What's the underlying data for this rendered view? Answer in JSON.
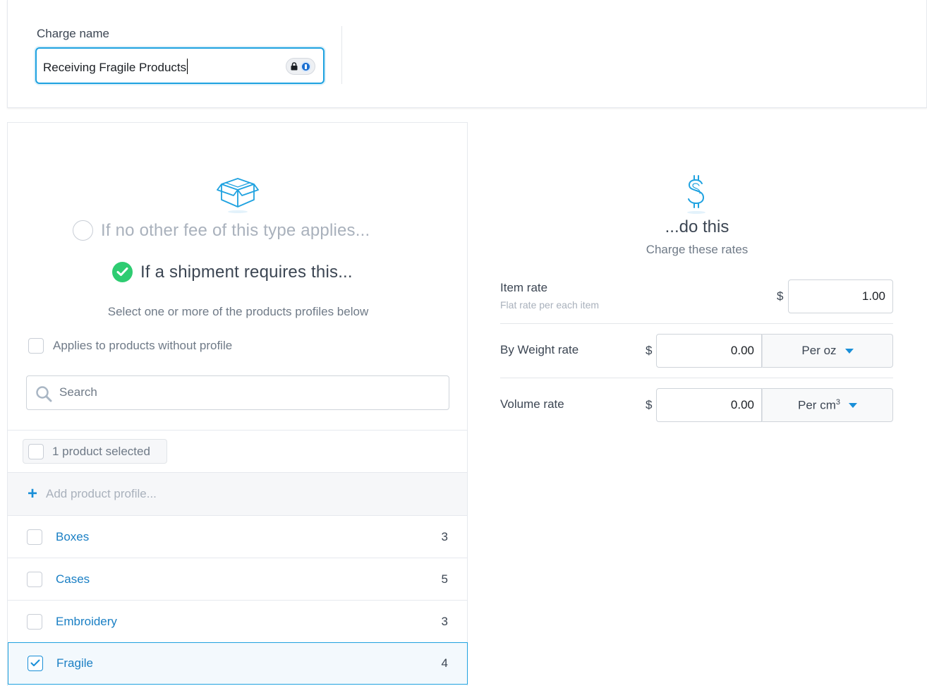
{
  "charge": {
    "label": "Charge name",
    "value": "Receiving Fragile Products"
  },
  "conditions": {
    "option_default": "If no other fee of this type applies...",
    "option_requires": "If a shipment requires this...",
    "hint": "Select one or more of the products profiles below",
    "applies_without_profile": "Applies to products without profile",
    "search_placeholder": "Search",
    "selected_summary": "1 product selected",
    "add_profile": "Add product profile..."
  },
  "profiles": [
    {
      "name": "Boxes",
      "count": "3",
      "checked": false
    },
    {
      "name": "Cases",
      "count": "5",
      "checked": false
    },
    {
      "name": "Embroidery",
      "count": "3",
      "checked": false
    },
    {
      "name": "Fragile",
      "count": "4",
      "checked": true
    }
  ],
  "action": {
    "title": "...do this",
    "subtitle": "Charge these rates",
    "item_rate": {
      "label": "Item rate",
      "sub": "Flat rate per each item",
      "currency": "$",
      "value": "1.00"
    },
    "weight_rate": {
      "label": "By Weight rate",
      "currency": "$",
      "value": "0.00",
      "unit": "Per oz"
    },
    "volume_rate": {
      "label": "Volume rate",
      "currency": "$",
      "value": "0.00",
      "unit": "Per cm",
      "unit_sup": "3"
    }
  },
  "colors": {
    "accent": "#1fa2e0",
    "link": "#1a7fc4",
    "success": "#2ecc71"
  }
}
